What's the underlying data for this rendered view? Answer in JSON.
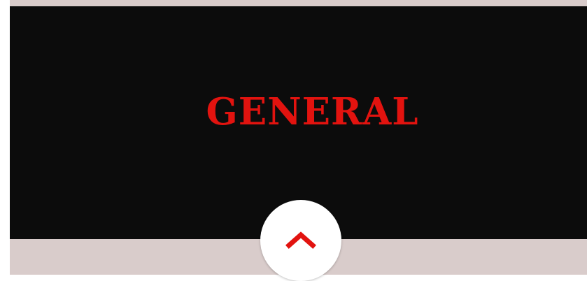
{
  "hero": {
    "title": "GENERAL",
    "title_color": "#e2130f",
    "background_color": "#0c0c0c"
  },
  "page": {
    "background_color": "#d9cccb"
  },
  "scroll_top_button": {
    "icon": "chevron-up-icon",
    "icon_color": "#e2130f",
    "background_color": "#ffffff"
  }
}
